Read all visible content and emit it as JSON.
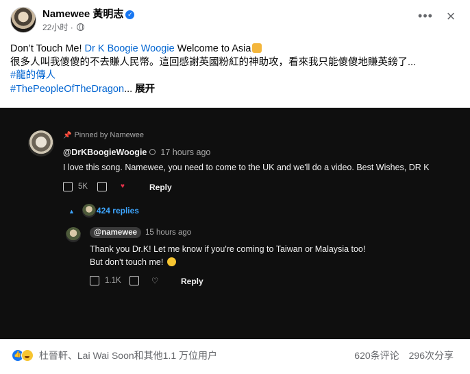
{
  "post": {
    "author": "Namewee 黃明志",
    "time": "22小时",
    "line1_prefix": "Don’t Touch Me!",
    "line1_link": "Dr K Boogie Woogie",
    "line1_suffix": "Welcome to Asia",
    "line2": "很多人叫我傻傻的不去賺人民幣。這回感謝英國粉紅的神助攻，看來我只能傻傻地賺英鎊了...",
    "hashtag1": "#龍的傳人",
    "hashtag2": "#ThePeopleOfTheDragon",
    "ellipsis": "...",
    "expand": "展开"
  },
  "youtube": {
    "pinned_label": "Pinned by Namewee",
    "handle": "@DrKBoogieWoogie",
    "time": "17 hours ago",
    "comment": "I love this song. Namewee, you need to come to the UK and we'll do a video. Best Wishes, DR K",
    "likes": "5K",
    "reply_label": "Reply",
    "replies_count": "424 replies",
    "reply": {
      "handle": "@namewee",
      "time": "15 hours ago",
      "line1": "Thank you Dr.K! Let me know if you're coming to Taiwan or Malaysia too!",
      "line2": "But don't touch me!",
      "likes": "1.1K",
      "reply_label": "Reply"
    }
  },
  "footer": {
    "reactions_text": "杜晉軒、Lai Wai Soon和其他1.1 万位用户",
    "comments": "620条评论",
    "shares": "296次分享"
  },
  "icons": [
    "globe-icon",
    "verified-badge-icon",
    "more-options-icon",
    "close-icon",
    "pin-icon",
    "thumbs-up-icon",
    "thumbs-down-icon",
    "heart-icon",
    "like-reaction-icon",
    "haha-reaction-icon",
    "smiley-emoji-icon"
  ]
}
